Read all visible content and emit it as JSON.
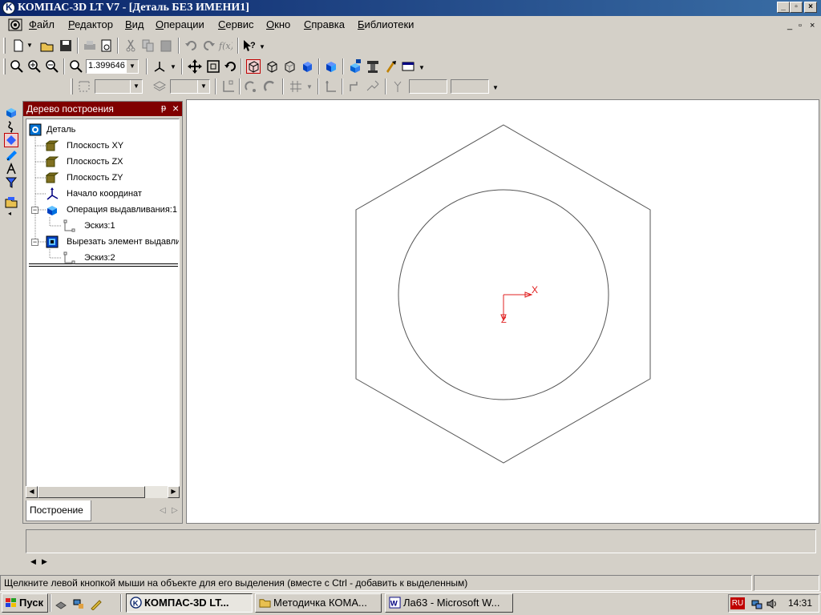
{
  "window": {
    "title": "КОМПАС-3D LT V7 - [Деталь БЕЗ ИМЕНИ1]",
    "min_label": "_",
    "max_label": "▫",
    "close_label": "×"
  },
  "menu": {
    "items": [
      "Файл",
      "Редактор",
      "Вид",
      "Операции",
      "Сервис",
      "Окно",
      "Справка",
      "Библиотеки"
    ],
    "mdi_min": "_",
    "mdi_restore": "▫",
    "mdi_close": "×"
  },
  "toolbar": {
    "zoom_value": "1.399646"
  },
  "tree": {
    "title": "Дерево построения",
    "pin": "ᵽ",
    "close": "×",
    "nodes": [
      {
        "label": "Деталь",
        "icon": "part-icon"
      },
      {
        "label": "Плоскость XY",
        "icon": "plane-icon"
      },
      {
        "label": "Плоскость ZX",
        "icon": "plane-icon"
      },
      {
        "label": "Плоскость ZY",
        "icon": "plane-icon"
      },
      {
        "label": "Начало координат",
        "icon": "origin-icon"
      },
      {
        "label": "Операция выдавливания:1",
        "icon": "extrude-icon"
      },
      {
        "label": "Эскиз:1",
        "icon": "sketch-icon"
      },
      {
        "label": "Вырезать элемент выдавли",
        "icon": "cut-extrude-icon"
      },
      {
        "label": "Эскиз:2",
        "icon": "sketch-icon"
      }
    ],
    "expander": "−",
    "tab": "Построение"
  },
  "viewport": {
    "axis_x": "X",
    "axis_z": "Z",
    "line_color": "#555555",
    "axis_color": "#e02020"
  },
  "status": {
    "message": "Щелкните левой кнопкой мыши на объекте для его выделения (вместе с Ctrl - добавить к выделенным)"
  },
  "taskbar": {
    "start": "Пуск",
    "buttons": [
      "КОМПАС-3D LT...",
      "Методичка КОМА...",
      "Ла63 - Microsoft W..."
    ],
    "lang": "RU",
    "clock": "14:31"
  }
}
